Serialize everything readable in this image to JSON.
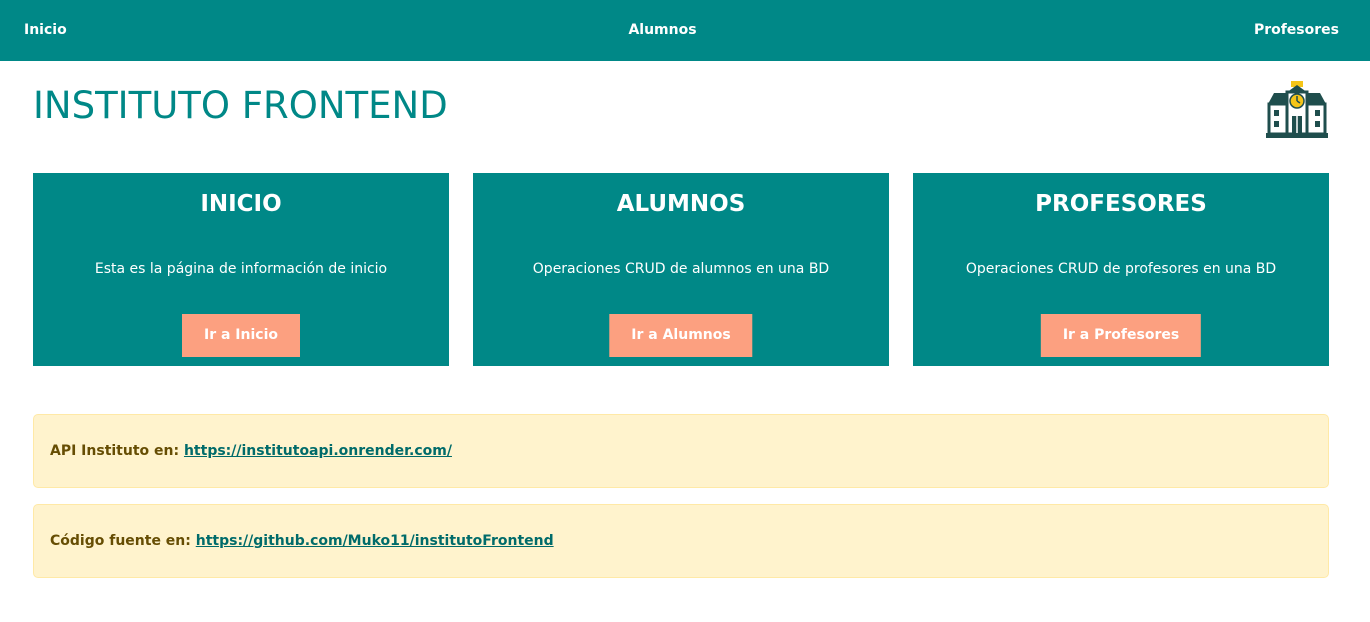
{
  "nav": {
    "inicio": "Inicio",
    "alumnos": "Alumnos",
    "profesores": "Profesores"
  },
  "header": {
    "title": "INSTITUTO FRONTEND",
    "icon": "school-building-icon"
  },
  "cards": [
    {
      "title": "INICIO",
      "text": "Esta es la página de información de inicio",
      "button": "Ir a Inicio"
    },
    {
      "title": "ALUMNOS",
      "text": "Operaciones CRUD de alumnos en una BD",
      "button": "Ir a Alumnos"
    },
    {
      "title": "PROFESORES",
      "text": "Operaciones CRUD de profesores en una BD",
      "button": "Ir a Profesores"
    }
  ],
  "info": {
    "api_label": "API Instituto en:",
    "api_link": "https://institutoapi.onrender.com/",
    "source_label": "Código fuente en:",
    "source_link": "https://github.com/Muko11/institutoFrontend"
  },
  "colors": {
    "primary": "#008887",
    "button": "#fca080",
    "alert_bg": "#fff3cd",
    "alert_text": "#664d03"
  }
}
